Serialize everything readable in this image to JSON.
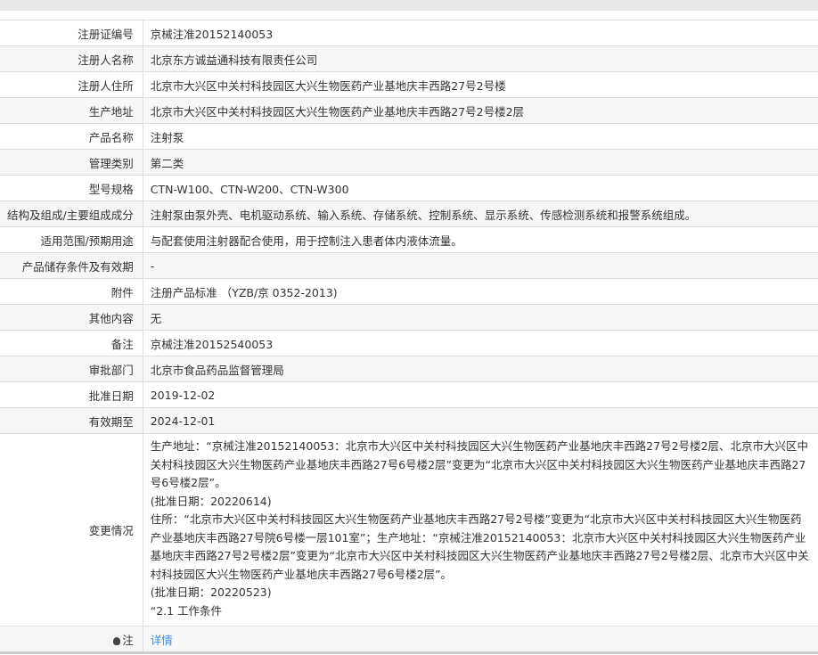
{
  "rows": [
    {
      "label": "注册证编号",
      "value": "京械注准20152140053"
    },
    {
      "label": "注册人名称",
      "value": "北京东方诚益通科技有限责任公司"
    },
    {
      "label": "注册人住所",
      "value": "北京市大兴区中关村科技园区大兴生物医药产业基地庆丰西路27号2号楼"
    },
    {
      "label": "生产地址",
      "value": "北京市大兴区中关村科技园区大兴生物医药产业基地庆丰西路27号2号楼2层"
    },
    {
      "label": "产品名称",
      "value": "注射泵"
    },
    {
      "label": "管理类别",
      "value": "第二类"
    },
    {
      "label": "型号规格",
      "value": "CTN-W100、CTN-W200、CTN-W300"
    },
    {
      "label": "结构及组成/主要组成成分",
      "value": "注射泵由泵外壳、电机驱动系统、输入系统、存储系统、控制系统、显示系统、传感检测系统和报警系统组成。"
    },
    {
      "label": "适用范围/预期用途",
      "value": "与配套使用注射器配合使用，用于控制注入患者体内液体流量。"
    },
    {
      "label": "产品储存条件及有效期",
      "value": "-"
    },
    {
      "label": "附件",
      "value": "注册产品标准 （YZB/京 0352-2013)"
    },
    {
      "label": "其他内容",
      "value": "无"
    },
    {
      "label": "备注",
      "value": "京械注准20152540053"
    },
    {
      "label": "审批部门",
      "value": "北京市食品药品监督管理局"
    },
    {
      "label": "批准日期",
      "value": "2019-12-02"
    },
    {
      "label": "有效期至",
      "value": "2024-12-01"
    }
  ],
  "change": {
    "label": "变更情况",
    "lines": [
      "生产地址：“京械注准20152140053：北京市大兴区中关村科技园区大兴生物医药产业基地庆丰西路27号2号楼2层、北京市大兴区中关村科技园区大兴生物医药产业基地庆丰西路27号6号楼2层”变更为“北京市大兴区中关村科技园区大兴生物医药产业基地庆丰西路27号6号楼2层”。",
      "(批准日期：20220614)",
      "住所：“北京市大兴区中关村科技园区大兴生物医药产业基地庆丰西路27号2号楼”变更为“北京市大兴区中关村科技园区大兴生物医药产业基地庆丰西路27号院6号楼一层101室”；生产地址：“京械注准20152140053：北京市大兴区中关村科技园区大兴生物医药产业基地庆丰西路27号2号楼2层”变更为“北京市大兴区中关村科技园区大兴生物医药产业基地庆丰西路27号2号楼2层、北京市大兴区中关村科技园区大兴生物医药产业基地庆丰西路27号6号楼2层”。",
      "(批准日期：20220523)",
      "“2.1 工作条件"
    ]
  },
  "note": {
    "label": "注",
    "link": "详情"
  }
}
